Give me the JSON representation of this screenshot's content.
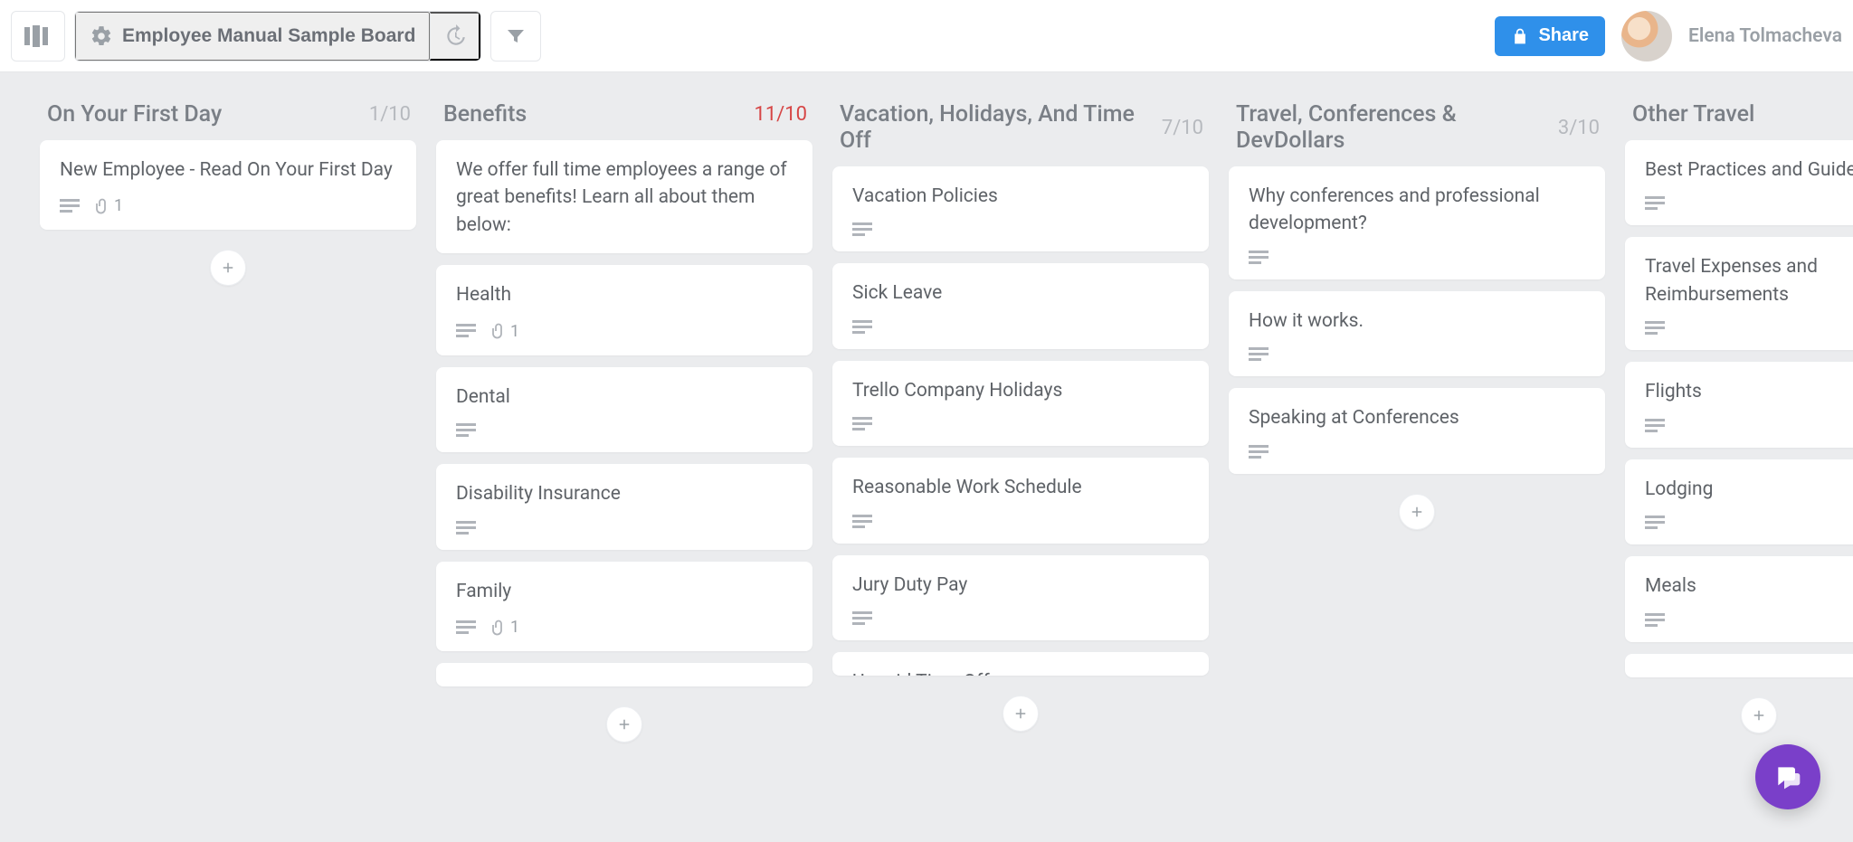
{
  "header": {
    "board_name": "Employee Manual Sample Board",
    "share_label": "Share",
    "user_name": "Elena Tolmacheva"
  },
  "lists": [
    {
      "title": "On Your First Day",
      "count": "1/10",
      "over": false,
      "cards": [
        {
          "title": "New Employee - Read On Your First Day",
          "has_desc": true,
          "attachments": "1"
        }
      ]
    },
    {
      "title": "Benefits",
      "count": "11/10",
      "over": true,
      "cards": [
        {
          "title": "We offer full time employees a range of great benefits! Learn all about them below:",
          "has_desc": false
        },
        {
          "title": "Health",
          "has_desc": true,
          "attachments": "1"
        },
        {
          "title": "Dental",
          "has_desc": true
        },
        {
          "title": "Disability Insurance",
          "has_desc": true
        },
        {
          "title": "Family",
          "has_desc": true,
          "attachments": "1"
        },
        {
          "title": "",
          "has_desc": false,
          "peek": true
        }
      ]
    },
    {
      "title": "Vacation, Holidays, And Time Off",
      "count": "7/10",
      "over": false,
      "cards": [
        {
          "title": "Vacation Policies",
          "has_desc": true
        },
        {
          "title": "Sick Leave",
          "has_desc": true
        },
        {
          "title": "Trello Company Holidays",
          "has_desc": true
        },
        {
          "title": "Reasonable Work Schedule",
          "has_desc": true
        },
        {
          "title": "Jury Duty Pay",
          "has_desc": true
        },
        {
          "title": "Unpaid Time Off",
          "has_desc": false,
          "peek": true
        }
      ]
    },
    {
      "title": "Travel, Conferences & DevDollars",
      "count": "3/10",
      "over": false,
      "cards": [
        {
          "title": "Why conferences and professional development?",
          "has_desc": true
        },
        {
          "title": "How it works.",
          "has_desc": true
        },
        {
          "title": "Speaking at Conferences",
          "has_desc": true
        }
      ]
    },
    {
      "title": "Other Travel",
      "count": "",
      "over": false,
      "clipped": true,
      "cards": [
        {
          "title": "Best Practices and Guide",
          "has_desc": true
        },
        {
          "title": "Travel Expenses and Reimbursements",
          "has_desc": true
        },
        {
          "title": "Flights",
          "has_desc": true
        },
        {
          "title": "Lodging",
          "has_desc": true
        },
        {
          "title": "Meals",
          "has_desc": true
        },
        {
          "title": "",
          "has_desc": false,
          "peek": true
        }
      ]
    }
  ]
}
